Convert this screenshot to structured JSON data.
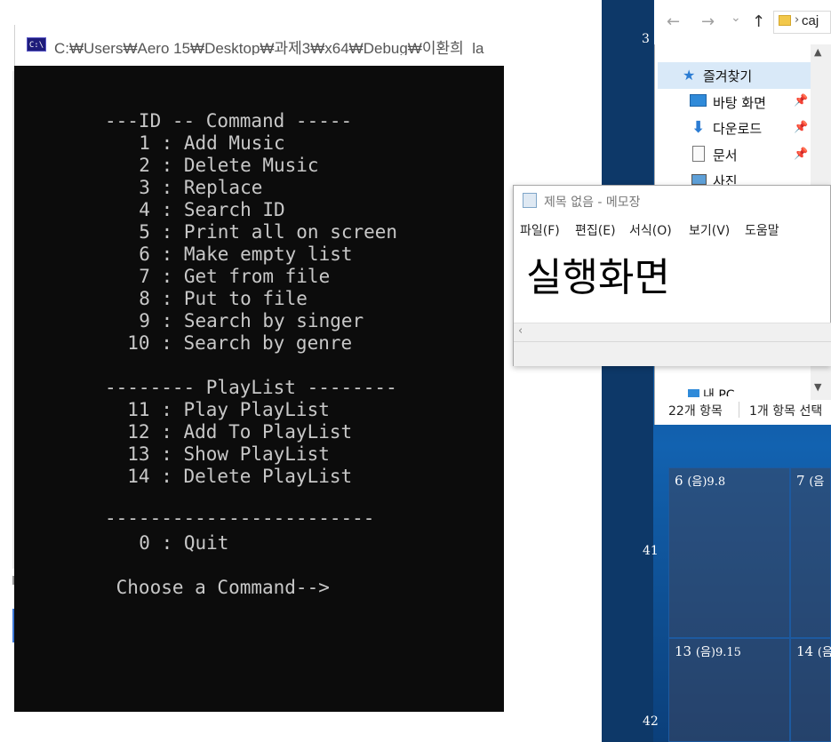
{
  "console": {
    "icon_label": "C:\\",
    "title": "C:₩Users₩Aero 15₩Desktop₩과제3₩x64₩Debug₩이환희_la",
    "lines": [
      "---ID -- Command -----",
      "  1 : Add Music",
      "  2 : Delete Music",
      "  3 : Replace",
      "  4 : Search ID",
      "  5 : Print all on screen",
      "  6 : Make empty list",
      "  7 : Get from file",
      "  8 : Put to file",
      "  9 : Search by singer",
      "  10 : Search by genre",
      "-------- PlayList --------",
      "  11 : Play PlayList",
      "  12 : Add To PlayList",
      "  13 : Show PlayList",
      "  14 : Delete PlayList",
      "------------------------",
      "  0 : Quit",
      " Choose a Command-->"
    ]
  },
  "explorer": {
    "nav": {
      "back": "←",
      "forward": "→",
      "dropdown": "⌄",
      "up": "↑",
      "separator": "›"
    },
    "address": "caj",
    "items": [
      {
        "label": "즐겨찾기",
        "icon": "star-icon"
      },
      {
        "label": "바탕 화면",
        "icon": "desktop-icon"
      },
      {
        "label": "다운로드",
        "icon": "download-icon"
      },
      {
        "label": "문서",
        "icon": "document-icon"
      },
      {
        "label": "사진",
        "icon": "pictures-icon"
      },
      {
        "label": "내 PC",
        "icon": "pc-icon"
      }
    ],
    "status_count": "22개 항목",
    "status_selected": "1개 항목 선택"
  },
  "notepad": {
    "title": "제목 없음 - 메모장",
    "menu": [
      "파일(F)",
      "편집(E)",
      "서식(O)",
      "보기(V)",
      "도움말"
    ],
    "content": "실행화면"
  },
  "calendar": {
    "edge_week": "3",
    "weeks": [
      {
        "number": "41",
        "day1": "6",
        "lunar1": "(음)9.8",
        "day2": "7",
        "lunar2": "(음"
      },
      {
        "number": "42",
        "day1": "13",
        "lunar1": "(음)9.15",
        "day2": "14",
        "lunar2": "(음"
      }
    ]
  },
  "colors": {
    "console_bg": "#0c0c0c",
    "console_text": "#c8c8c8",
    "desktop_blue": "#0c4a8e",
    "quick_access_highlight": "#d9e9f8"
  }
}
